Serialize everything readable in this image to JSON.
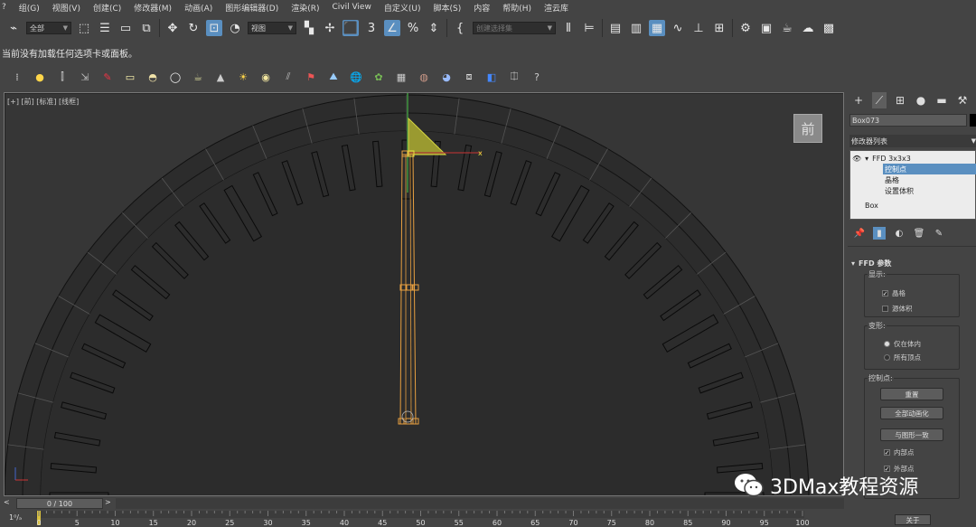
{
  "menubar": {
    "items": [
      "?",
      "组(G)",
      "视图(V)",
      "创建(C)",
      "修改器(M)",
      "动画(A)",
      "图形编辑器(D)",
      "渲染(R)",
      "Civil View",
      "自定义(U)",
      "脚本(S)",
      "内容",
      "帮助(H)",
      "渲云库"
    ]
  },
  "toolbar": {
    "selection_filter": "全部",
    "ref_coord": "视图",
    "named_selection_placeholder": "创建选择集"
  },
  "prompt": {
    "text": "当前没有加载任何选项卡或面板。"
  },
  "viewport": {
    "label": "[+] [前] [标准] [线框]",
    "viewcube_label": "前",
    "axis_x_label": "x"
  },
  "command_panel": {
    "object_name": "Box073",
    "modifier_list": "修改器列表",
    "stack": {
      "ffd": "FFD 3x3x3",
      "control_points": "控制点",
      "lattice": "晶格",
      "set_volume": "设置体积",
      "base": "Box"
    },
    "rollout_title": "FFD 参数",
    "display_group": "显示:",
    "lattice_option": "晶格",
    "source_volume_option": "源体积",
    "deform_group": "变形:",
    "only_in_volume": "仅在体内",
    "all_vertices": "所有顶点",
    "control_points_group": "控制点:",
    "reset_button": "重置",
    "animate_all_button": "全部动画化",
    "conform_button": "与图形一致",
    "inside_points": "内部点",
    "outside_points": "外部点",
    "about_button": "关于"
  },
  "timeslider": {
    "frame_text": "0 / 100",
    "left_arrow": "<",
    "right_arrow": ">"
  },
  "trackbar": {
    "label": "1⁰/ₔ",
    "ticks": [
      "0",
      "5",
      "10",
      "15",
      "20",
      "25",
      "30",
      "35",
      "40",
      "45",
      "50",
      "55",
      "60",
      "65",
      "70",
      "75",
      "80",
      "85",
      "90",
      "95",
      "100"
    ]
  },
  "watermark": {
    "text": "3DMax教程资源"
  },
  "colors": {
    "ui_bg": "#444444",
    "viewport_bg": "#2c2c2c",
    "active_blue": "#5a8fc0",
    "selection_orange": "#e8a040",
    "gizmo_yellow": "#d8d840"
  }
}
